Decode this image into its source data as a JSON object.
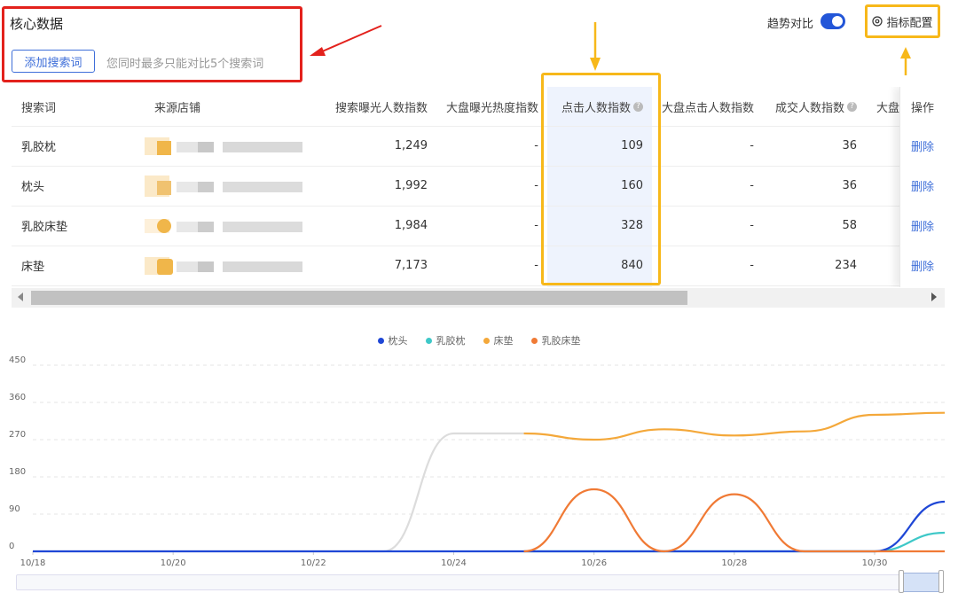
{
  "header": {
    "title": "核心数据",
    "add_button": "添加搜索词",
    "hint": "您同时最多只能对比5个搜索词",
    "trend_label": "趋势对比",
    "trend_on": true,
    "metric_config": "指标配置"
  },
  "table": {
    "columns": [
      "搜索词",
      "来源店铺",
      "搜索曝光人数指数",
      "大盘曝光热度指数",
      "点击人数指数",
      "大盘点击人数指数",
      "成交人数指数",
      "大盘",
      "操作"
    ],
    "rows": [
      {
        "term": "乳胶枕",
        "exposure": "1,249",
        "market_exposure": "-",
        "clicks": "109",
        "market_clicks": "-",
        "deals": "36",
        "action": "删除"
      },
      {
        "term": "枕头",
        "exposure": "1,992",
        "market_exposure": "-",
        "clicks": "160",
        "market_clicks": "-",
        "deals": "36",
        "action": "删除"
      },
      {
        "term": "乳胶床垫",
        "exposure": "1,984",
        "market_exposure": "-",
        "clicks": "328",
        "market_clicks": "-",
        "deals": "58",
        "action": "删除"
      },
      {
        "term": "床垫",
        "exposure": "7,173",
        "market_exposure": "-",
        "clicks": "840",
        "market_clicks": "-",
        "deals": "234",
        "action": "删除"
      }
    ]
  },
  "colors": {
    "accent": "#3f6fd9",
    "annotation_red": "#e3211c",
    "annotation_yellow": "#f7b81a",
    "highlight_column": "#eef3fd"
  },
  "chart_data": {
    "type": "line",
    "x": [
      "10/18",
      "10/19",
      "10/20",
      "10/21",
      "10/22",
      "10/23",
      "10/24",
      "10/25",
      "10/26",
      "10/27",
      "10/28",
      "10/29",
      "10/30",
      "10/31"
    ],
    "x_tick_labels": [
      "10/18",
      "10/20",
      "10/22",
      "10/24",
      "10/26",
      "10/28",
      "10/30"
    ],
    "y_ticks": [
      "0",
      "90",
      "180",
      "270",
      "360",
      "450"
    ],
    "ylim": [
      0,
      450
    ],
    "grid": true,
    "legend_position": "top-center",
    "series": [
      {
        "name": "枕头",
        "color": "#1f47d6",
        "values": [
          0,
          0,
          0,
          0,
          0,
          0,
          0,
          0,
          0,
          0,
          0,
          0,
          0,
          120
        ]
      },
      {
        "name": "乳胶枕",
        "color": "#3ec8c8",
        "values": [
          null,
          null,
          null,
          null,
          null,
          null,
          null,
          0,
          0,
          0,
          0,
          0,
          0,
          45
        ]
      },
      {
        "name": "床垫",
        "color": "#f4a83a",
        "values": [
          null,
          null,
          null,
          null,
          null,
          null,
          null,
          285,
          270,
          295,
          280,
          290,
          330,
          335
        ]
      },
      {
        "name": "乳胶床垫",
        "color": "#f07a35",
        "values": [
          null,
          null,
          null,
          null,
          null,
          null,
          null,
          0,
          150,
          0,
          138,
          0,
          0,
          0
        ]
      },
      {
        "name": "",
        "color": "#dcdcdc",
        "values": [
          0,
          0,
          0,
          0,
          0,
          0,
          285,
          285,
          null,
          null,
          null,
          null,
          null,
          null
        ]
      }
    ]
  }
}
